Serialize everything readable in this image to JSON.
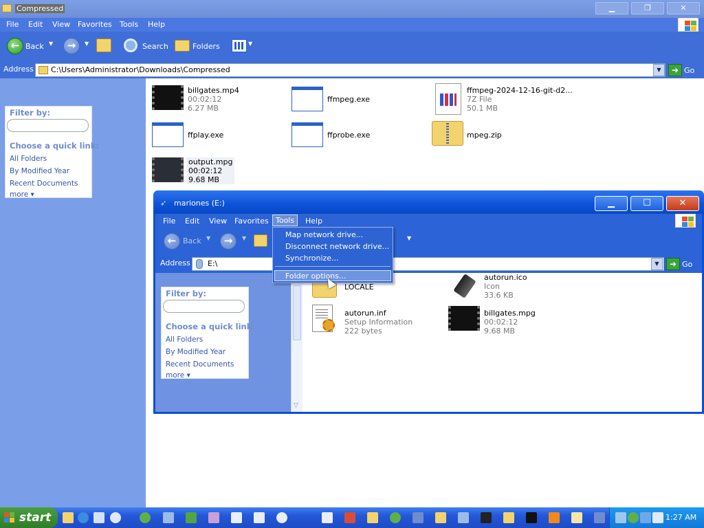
{
  "back_window": {
    "title": "Compressed",
    "menu": [
      "File",
      "Edit",
      "View",
      "Favorites",
      "Tools",
      "Help"
    ],
    "toolbar": {
      "back": "Back",
      "search": "Search",
      "folders": "Folders"
    },
    "address_label": "Address",
    "address_value": "C:\\Users\\Administrator\\Downloads\\Compressed",
    "go_label": "Go",
    "sidebar": {
      "filter_by": "Filter by:",
      "quick_link_heading": "Choose a quick link:",
      "links": [
        "All Folders",
        "By Modified Year",
        "Recent Documents",
        "more ▾"
      ]
    },
    "files": [
      {
        "name": "billgates.mp4",
        "line2": "00:02:12",
        "line3": "6.27 MB",
        "icon": "video-thumbnail"
      },
      {
        "name": "ffmpeg.exe",
        "line2": "",
        "line3": "",
        "icon": "exe-window-icon"
      },
      {
        "name": "ffmpeg-2024-12-16-git-d2...",
        "line2": "7Z File",
        "line3": "50.1 MB",
        "icon": "7z-file-icon"
      },
      {
        "name": "ffplay.exe",
        "line2": "",
        "line3": "",
        "icon": "exe-window-icon"
      },
      {
        "name": "ffprobe.exe",
        "line2": "",
        "line3": "",
        "icon": "exe-window-icon"
      },
      {
        "name": "mpeg.zip",
        "line2": "",
        "line3": "",
        "icon": "zip-folder-icon"
      },
      {
        "name": "output.mpg",
        "line2": "00:02:12",
        "line3": "9.68 MB",
        "icon": "video-thumbnail"
      }
    ]
  },
  "front_window": {
    "title": "mariones (E:)",
    "menu": [
      "File",
      "Edit",
      "View",
      "Favorites",
      "Tools",
      "Help"
    ],
    "toolbar": {
      "back": "Back"
    },
    "address_label": "Address",
    "address_value": "E:\\",
    "go_label": "Go",
    "sidebar": {
      "filter_by": "Filter by:",
      "quick_link_heading": "Choose a quick link:",
      "links": [
        "All Folders",
        "By Modified Year",
        "Recent Documents",
        "more ▾"
      ]
    },
    "files": [
      {
        "name": "LOCALE",
        "line2": "",
        "line3": "",
        "icon": "folder-icon"
      },
      {
        "name": "autorun.ico",
        "line2": "Icon",
        "line3": "33.6 KB",
        "icon": "usb-drive-icon"
      },
      {
        "name": "autorun.inf",
        "line2": "Setup Information",
        "line3": "222 bytes",
        "icon": "setup-info-icon"
      },
      {
        "name": "billgates.mpg",
        "line2": "00:02:12",
        "line3": "9.68 MB",
        "icon": "video-thumbnail"
      }
    ]
  },
  "tools_menu": {
    "items": [
      "Map network drive...",
      "Disconnect network drive...",
      "Synchronize...",
      "Folder options..."
    ],
    "highlighted": "Folder options..."
  },
  "taskbar": {
    "start_label": "start",
    "clock": "1:27 AM"
  },
  "colors": {
    "xp_blue": "#0a4fd9",
    "menu_blue": "#2c63d6",
    "sidebar_blue": "#7b9ee8",
    "start_green": "#3a8d31",
    "close_red": "#d2462a"
  }
}
